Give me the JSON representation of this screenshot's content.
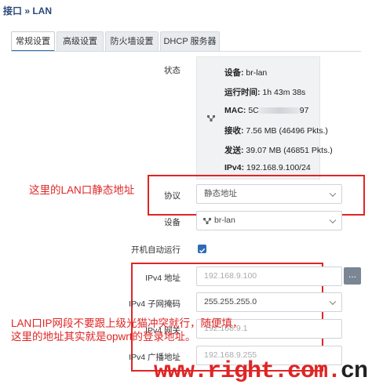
{
  "breadcrumb": "接口 » LAN",
  "tabs": [
    "常规设置",
    "高级设置",
    "防火墙设置",
    "DHCP 服务器"
  ],
  "status": {
    "label": "状态",
    "device_label": "设备:",
    "device": "br-lan",
    "uptime_label": "运行时间:",
    "uptime": "1h 43m 38s",
    "mac_label": "MAC:",
    "mac_prefix": "5C",
    "mac_suffix": "97",
    "rx_label": "接收:",
    "rx": "7.56 MB (46496 Pkts.)",
    "tx_label": "发送:",
    "tx": "39.07 MB (46851 Pkts.)",
    "ipv4_label": "IPv4:",
    "ipv4": "192.168.9.100/24"
  },
  "protocol": {
    "label": "协议",
    "value": "静态地址"
  },
  "device_field": {
    "label": "设备",
    "value": "br-lan"
  },
  "autostart": {
    "label": "开机自动运行",
    "checked": true
  },
  "ipv4_address": {
    "label": "IPv4 地址",
    "placeholder": "192.168.9.100"
  },
  "ipv4_netmask": {
    "label": "IPv4 子网掩码",
    "value": "255.255.255.0"
  },
  "ipv4_gateway": {
    "label": "IPv4 网关",
    "placeholder": "192.168.9.1"
  },
  "ipv4_broadcast": {
    "label": "IPv4 广播地址",
    "placeholder": "192.168.9.255"
  },
  "annotations": {
    "lan_static": "这里的LAN口静态地址",
    "note_line1": "LAN口IP网段不要跟上级光猫冲突就行，随便填，",
    "note_line2": "这里的地址其实就是opwrt的登录地址。"
  },
  "watermark": {
    "main": "www.right.com.",
    "suffix": "cn"
  },
  "colors": {
    "annotation_red": "#e02525",
    "accent_blue": "#2d6bb4"
  }
}
